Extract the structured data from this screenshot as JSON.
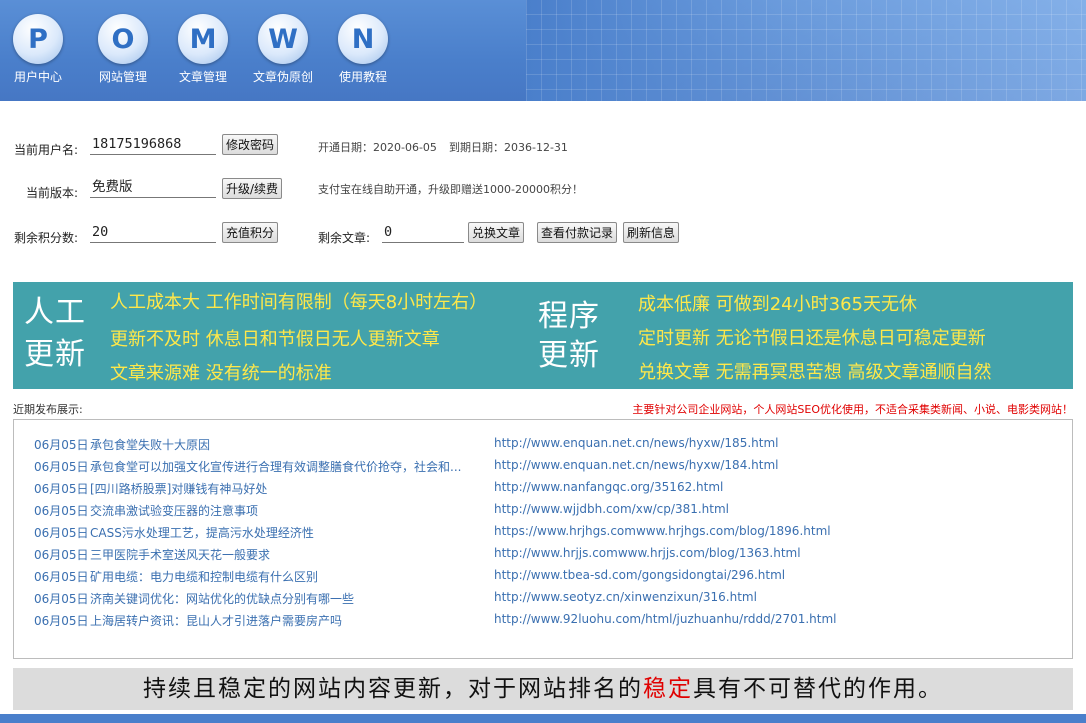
{
  "nav": [
    {
      "letter": "P",
      "label": "用户中心"
    },
    {
      "letter": "O",
      "label": "网站管理"
    },
    {
      "letter": "M",
      "label": "文章管理"
    },
    {
      "letter": "W",
      "label": "文章伪原创"
    },
    {
      "letter": "N",
      "label": "使用教程"
    }
  ],
  "account": {
    "username_label": "当前用户名:",
    "username": "18175196868",
    "change_password_btn": "修改密码",
    "open_date": "开通日期：2020-06-05",
    "expire_date": "到期日期：2036-12-31",
    "version_label": "当前版本:",
    "version": "免费版",
    "upgrade_btn": "升级/续费",
    "upgrade_note": "支付宝在线自助开通，升级即赠送1000-20000积分！",
    "points_label": "剩余积分数:",
    "points": "20",
    "recharge_btn": "充值积分",
    "articles_label": "剩余文章:",
    "articles": "0",
    "exchange_btn": "兑换文章",
    "payment_records_btn": "查看付款记录",
    "refresh_btn": "刷新信息"
  },
  "banner": {
    "left_title_1": "人工",
    "left_title_2": "更新",
    "left_lines": [
      "人工成本大  工作时间有限制（每天8小时左右）",
      "更新不及时  休息日和节假日无人更新文章",
      "文章来源难  没有统一的标准"
    ],
    "right_title_1": "程序",
    "right_title_2": "更新",
    "right_lines": [
      "成本低廉  可做到24小时365天无休",
      "定时更新  无论节假日还是休息日可稳定更新",
      "兑换文章  无需再冥思苦想  高级文章通顺自然"
    ]
  },
  "recent": {
    "label": "近期发布展示:",
    "note": "主要针对公司企业网站，个人网站SEO优化使用，不适合采集类新闻、小说、电影类网站！",
    "items": [
      {
        "date": "06月05日",
        "title": "承包食堂失败十大原因",
        "url": "http://www.enquan.net.cn/news/hyxw/185.html"
      },
      {
        "date": "06月05日",
        "title": "承包食堂可以加强文化宣传进行合理有效调整膳食代价抢夺，社会和...",
        "url": "http://www.enquan.net.cn/news/hyxw/184.html"
      },
      {
        "date": "06月05日",
        "title": "[四川路桥股票]对赚钱有神马好处",
        "url": "http://www.nanfangqc.org/35162.html"
      },
      {
        "date": "06月05日",
        "title": "交流串激试验变压器的注意事项",
        "url": "http://www.wjjdbh.com/xw/cp/381.html"
      },
      {
        "date": "06月05日",
        "title": "CASS污水处理工艺，提高污水处理经济性",
        "url": "https://www.hrjhgs.comwww.hrjhgs.com/blog/1896.html"
      },
      {
        "date": "06月05日",
        "title": "三甲医院手术室送风天花一般要求",
        "url": "http://www.hrjjs.comwww.hrjjs.com/blog/1363.html"
      },
      {
        "date": "06月05日",
        "title": "矿用电缆：电力电缆和控制电缆有什么区别",
        "url": "http://www.tbea-sd.com/gongsidongtai/296.html"
      },
      {
        "date": "06月05日",
        "title": "济南关键词优化：网站优化的优缺点分别有哪一些",
        "url": "http://www.seotyz.cn/xinwenzixun/316.html"
      },
      {
        "date": "06月05日",
        "title": "上海居转户资讯：昆山人才引进落户需要房产吗",
        "url": "http://www.92luohu.com/html/juzhuanhu/rddd/2701.html"
      }
    ]
  },
  "slogan": {
    "before": "持续且稳定的网站内容更新，对于网站排名的",
    "highlight": "稳定",
    "after": "具有不可替代的作用。"
  }
}
